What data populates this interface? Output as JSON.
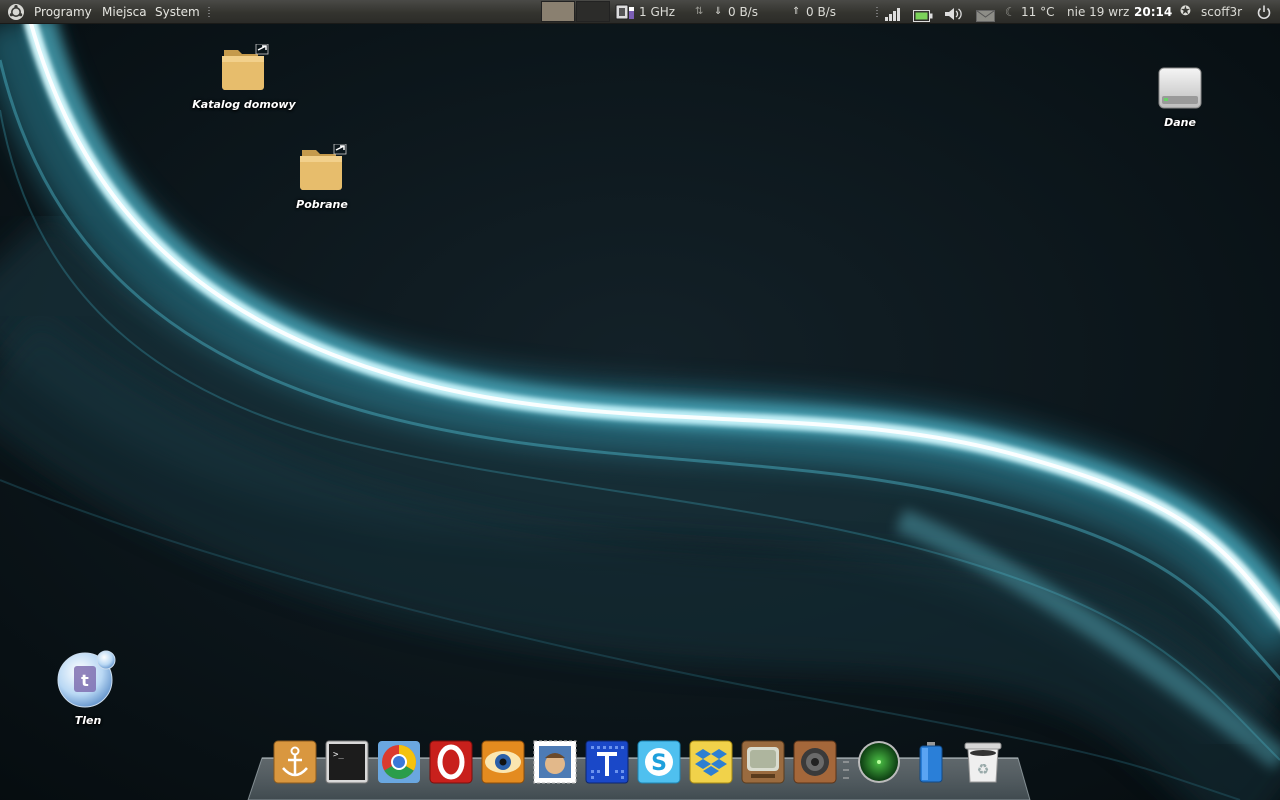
{
  "panel": {
    "menus": [
      "Programy",
      "Miejsca",
      "System"
    ],
    "cpu_freq": "1 GHz",
    "net_down": "0 B/s",
    "net_up": "0 B/s",
    "temperature": "11 °C",
    "date": "nie 19 wrz",
    "time": "20:14",
    "user": "scoff3r"
  },
  "desktop": {
    "icons": [
      {
        "label": "Katalog domowy",
        "icon": "folder-icon"
      },
      {
        "label": "Pobrane",
        "icon": "folder-icon"
      },
      {
        "label": "Dane",
        "icon": "drive-icon"
      },
      {
        "label": "Tlen",
        "icon": "tlen-icon"
      }
    ]
  },
  "dock": {
    "items": [
      "anchor-icon",
      "terminal-icon",
      "chrome-icon",
      "opera-icon",
      "eye-icon",
      "stamp-icon",
      "grid-icon",
      "skype-icon",
      "dropbox-icon",
      "tv-icon",
      "speaker-icon",
      "radar-icon",
      "battery-icon",
      "trash-icon"
    ]
  },
  "colors": {
    "panel_bg": "#3a3a36",
    "panel_text": "#dcdcd7",
    "wallpaper_dark": "#0b151a",
    "wallpaper_glow": "#bff4ff",
    "wallpaper_teal": "#2e8ea4"
  }
}
